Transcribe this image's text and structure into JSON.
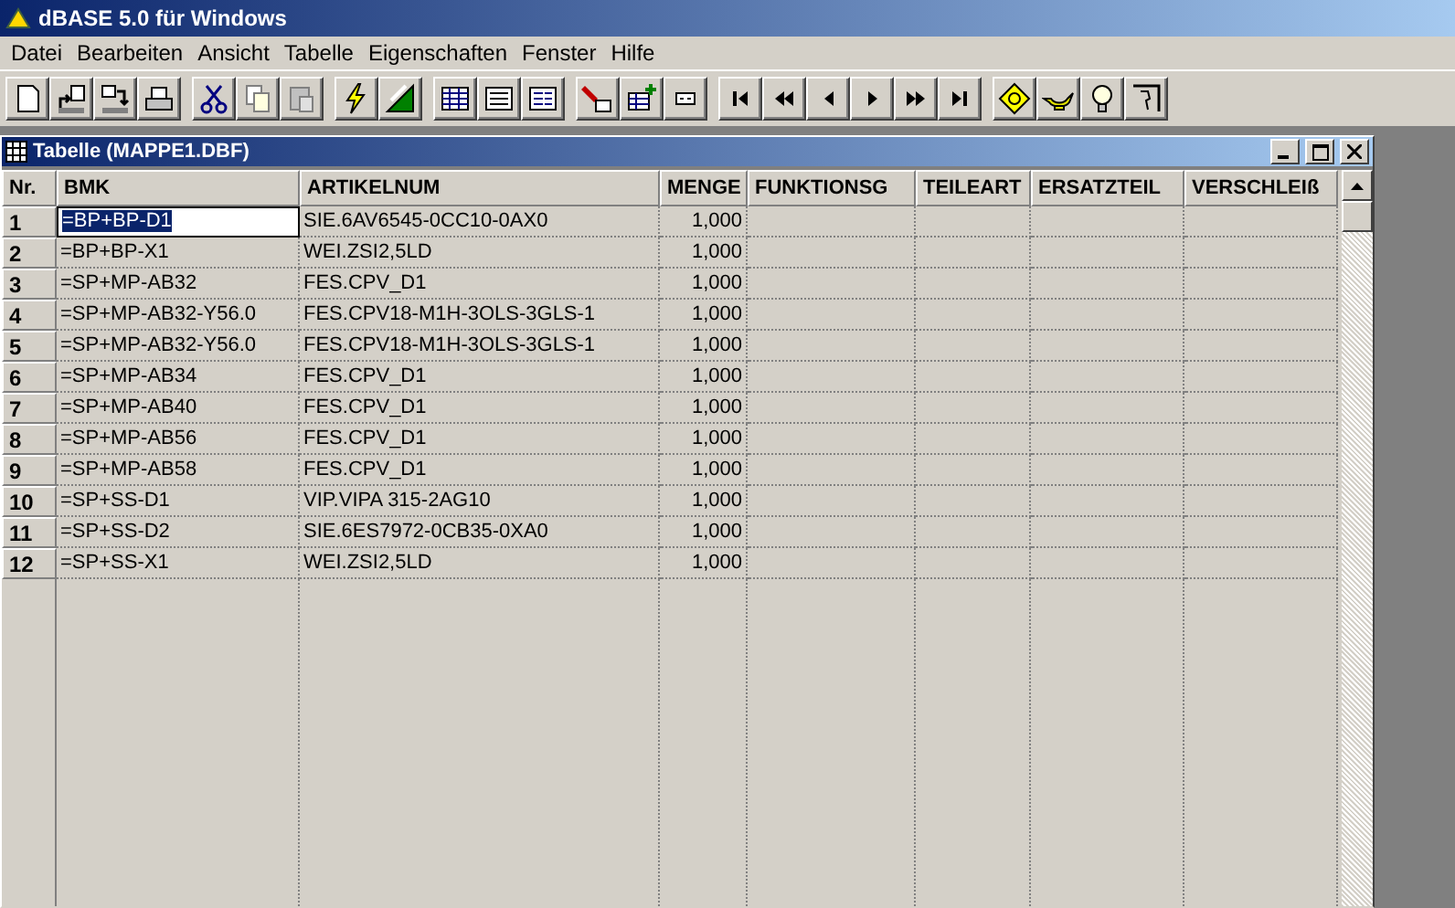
{
  "window": {
    "title": "dBASE 5.0 für Windows"
  },
  "menu": [
    "Datei",
    "Bearbeiten",
    "Ansicht",
    "Tabelle",
    "Eigenschaften",
    "Fenster",
    "Hilfe"
  ],
  "child_window": {
    "title": "Tabelle (MAPPE1.DBF)"
  },
  "table": {
    "columns": [
      "Nr.",
      "BMK",
      "ARTIKELNUM",
      "MENGE",
      "FUNKTIONSG",
      "TEILEART",
      "ERSATZTEIL",
      "VERSCHLEIß"
    ],
    "rows": [
      {
        "nr": "1",
        "bmk": "=BP+BP-D1",
        "artikelnum": "SIE.6AV6545-0CC10-0AX0",
        "menge": "1,000",
        "selected": true
      },
      {
        "nr": "2",
        "bmk": "=BP+BP-X1",
        "artikelnum": "WEI.ZSI2,5LD",
        "menge": "1,000",
        "selected": false
      },
      {
        "nr": "3",
        "bmk": "=SP+MP-AB32",
        "artikelnum": "FES.CPV_D1",
        "menge": "1,000",
        "selected": false
      },
      {
        "nr": "4",
        "bmk": "=SP+MP-AB32-Y56.0",
        "artikelnum": "FES.CPV18-M1H-3OLS-3GLS-1",
        "menge": "1,000",
        "selected": false
      },
      {
        "nr": "5",
        "bmk": "=SP+MP-AB32-Y56.0",
        "artikelnum": "FES.CPV18-M1H-3OLS-3GLS-1",
        "menge": "1,000",
        "selected": false
      },
      {
        "nr": "6",
        "bmk": "=SP+MP-AB34",
        "artikelnum": "FES.CPV_D1",
        "menge": "1,000",
        "selected": false
      },
      {
        "nr": "7",
        "bmk": "=SP+MP-AB40",
        "artikelnum": "FES.CPV_D1",
        "menge": "1,000",
        "selected": false
      },
      {
        "nr": "8",
        "bmk": "=SP+MP-AB56",
        "artikelnum": "FES.CPV_D1",
        "menge": "1,000",
        "selected": false
      },
      {
        "nr": "9",
        "bmk": "=SP+MP-AB58",
        "artikelnum": "FES.CPV_D1",
        "menge": "1,000",
        "selected": false
      },
      {
        "nr": "10",
        "bmk": "=SP+SS-D1",
        "artikelnum": "VIP.VIPA 315-2AG10",
        "menge": "1,000",
        "selected": false
      },
      {
        "nr": "11",
        "bmk": "=SP+SS-D2",
        "artikelnum": "SIE.6ES7972-0CB35-0XA0",
        "menge": "1,000",
        "selected": false
      },
      {
        "nr": "12",
        "bmk": "=SP+SS-X1",
        "artikelnum": "WEI.ZSI2,5LD",
        "menge": "1,000",
        "selected": false
      }
    ]
  }
}
